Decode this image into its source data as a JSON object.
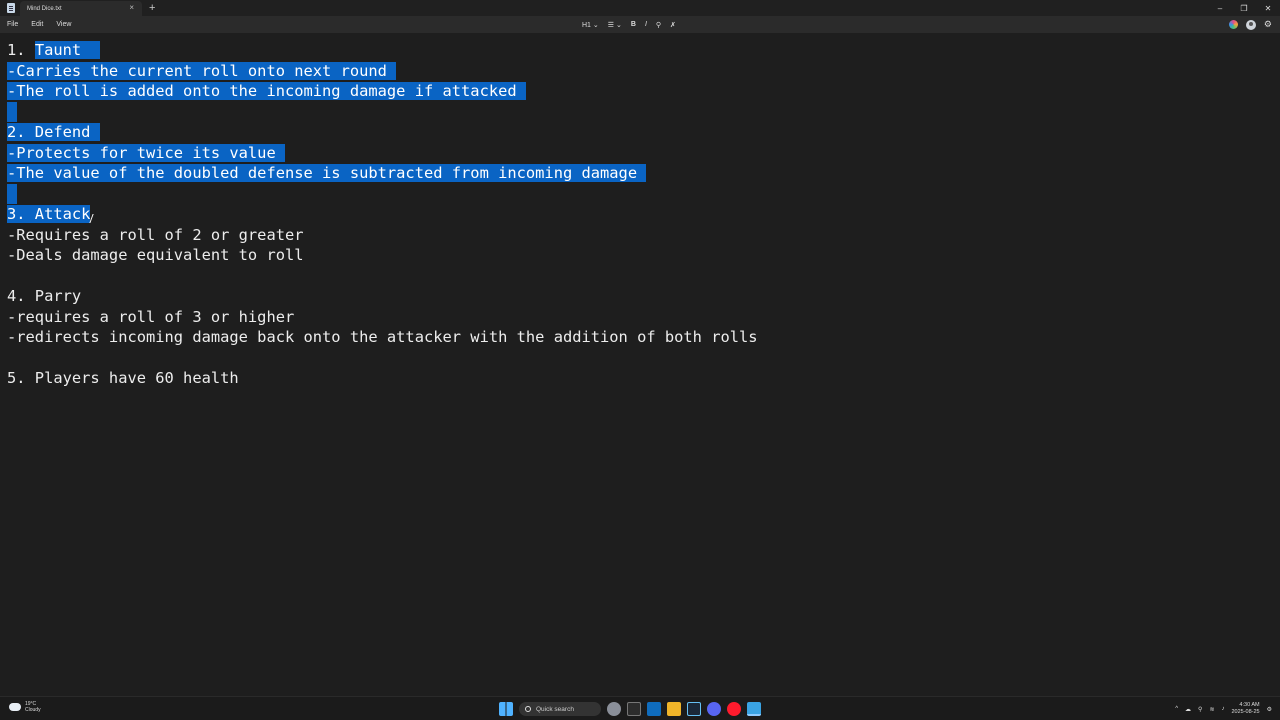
{
  "window": {
    "tab_title": "Mind Dice.txt",
    "tab_close": "×",
    "new_tab": "+",
    "minimize": "–",
    "maximize": "❐",
    "close": "✕"
  },
  "menu": {
    "file": "File",
    "edit": "Edit",
    "view": "View"
  },
  "toolbar": {
    "heading": "H1",
    "heading_chevron": "⌄",
    "list": "☰",
    "list_chevron": "⌄",
    "bold": "B",
    "italic": "I",
    "link": "⚲",
    "clear_format": "✗"
  },
  "document": {
    "l1": "1. Taunt",
    "l1_num": "1. ",
    "l1_rest": "Taunt  ",
    "l2": "-Carries the current roll onto next round ",
    "l3": "-The roll is added onto the incoming damage if attacked ",
    "l5": "2. Defend ",
    "l6": "-Protects for twice its value ",
    "l7": "-The value of the doubled defense is subtracted from incoming damage ",
    "l9": "3. Attack",
    "l10": "-Requires a roll of 2 or greater",
    "l11": "-Deals damage equivalent to roll",
    "l13": "4. Parry",
    "l14": "-requires a roll of 3 or higher",
    "l15": "-redirects incoming damage back onto the attacker with the addition of both rolls",
    "l17": "5. Players have 60 health"
  },
  "taskbar": {
    "temperature": "19°C",
    "condition": "Cloudy",
    "search_placeholder": "Quick search",
    "time": "4:30 AM",
    "date": "2025-08-25",
    "tray_chevron": "^"
  },
  "colors": {
    "selection": "#0a64c4",
    "editor_bg": "#1e1e1e",
    "titlebar_bg": "#202020"
  }
}
